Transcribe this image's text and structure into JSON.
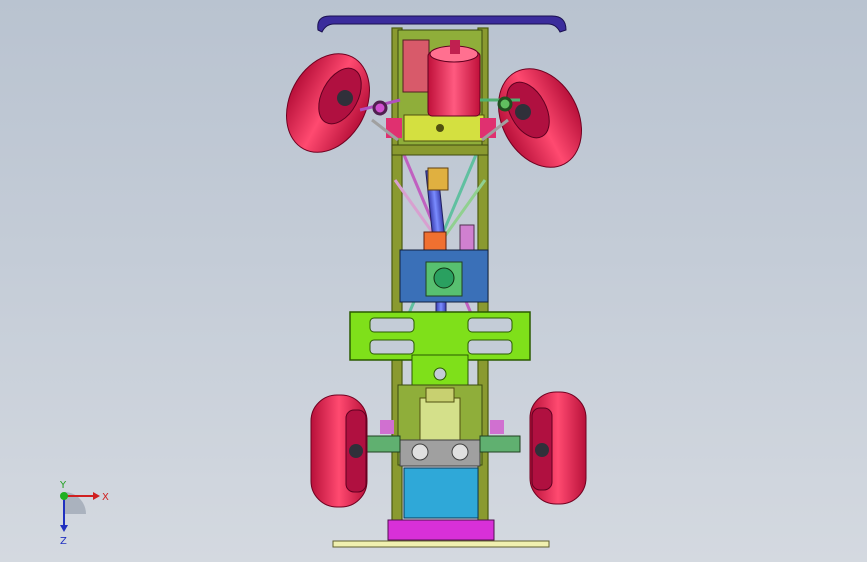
{
  "triad": {
    "x_label": "X",
    "y_label": "Y",
    "z_label": "Z"
  },
  "colors": {
    "background_top": "#b9c3d0",
    "background_bottom": "#d4d9e0",
    "wheel": "#e8204f",
    "chassis_plate": "#7fe01a",
    "wing": "#3b2c9c",
    "motor": "#f0305a",
    "gearbox": "#3a70b8",
    "battery": "#2fa8d8",
    "frame": "#6a7a2a"
  }
}
